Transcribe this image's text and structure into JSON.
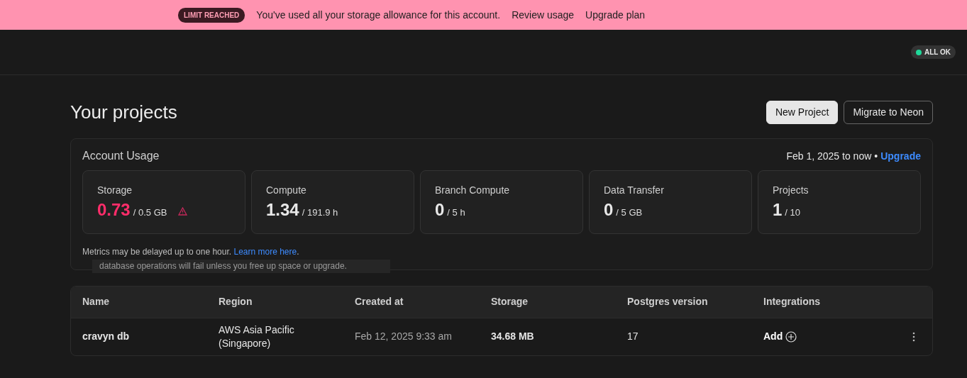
{
  "banner": {
    "badge": "LIMIT REACHED",
    "message": "You've used all your storage allowance for this account.",
    "links": [
      "Review usage",
      "Upgrade plan"
    ]
  },
  "status": {
    "label": "ALL OK",
    "color": "#1fd89a"
  },
  "page": {
    "title": "Your projects",
    "buttons": [
      {
        "label": "New Project",
        "kind": "primary"
      },
      {
        "label": "Migrate to Neon",
        "kind": "outline"
      }
    ]
  },
  "usage": {
    "title": "Account Usage",
    "period": "Feb 1, 2025 to now",
    "separator": "•",
    "upgrade_link": "Upgrade",
    "metrics": [
      {
        "label": "Storage",
        "value": "0.73",
        "limit": "/ 0.5 GB",
        "over_limit": true
      },
      {
        "label": "Compute",
        "value": "1.34",
        "limit": "/ 191.9 h",
        "over_limit": false
      },
      {
        "label": "Branch Compute",
        "value": "0",
        "limit": "/ 5 h",
        "over_limit": false
      },
      {
        "label": "Data Transfer",
        "value": "0",
        "limit": "/ 5 GB",
        "over_limit": false
      },
      {
        "label": "Projects",
        "value": "1",
        "limit": "/ 10",
        "over_limit": false
      }
    ],
    "note": "Metrics may be delayed up to one hour.",
    "note_link": "Learn more here",
    "note_end": "."
  },
  "tooltip": {
    "text": "database operations will fail unless you free up space or upgrade."
  },
  "table": {
    "columns": [
      "Name",
      "Region",
      "Created at",
      "Storage",
      "Postgres version",
      "Integrations"
    ],
    "rows": [
      {
        "name": "cravyn db",
        "region": "AWS Asia Pacific (Singapore)",
        "created": "Feb 12, 2025 9:33 am",
        "storage": "34.68 MB",
        "version": "17",
        "integration": "Add"
      }
    ]
  }
}
